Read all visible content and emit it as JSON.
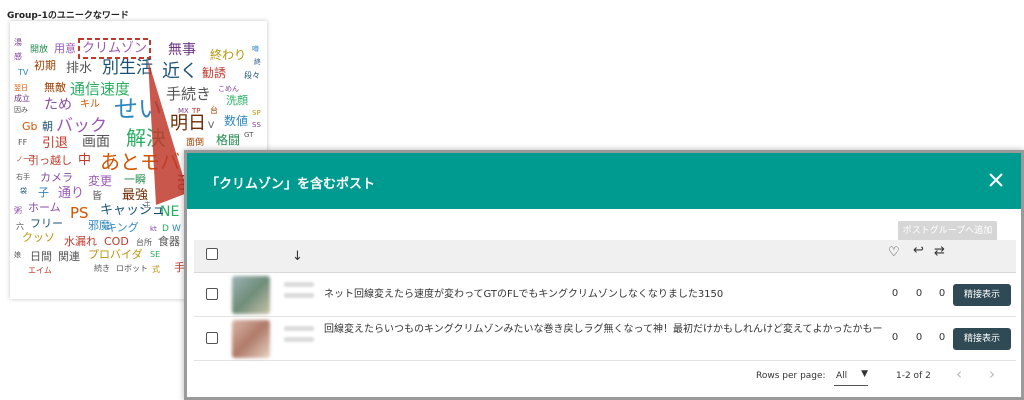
{
  "section_title": "Group-1のユニークなワード",
  "word_cloud": {
    "highlighted_word": "クリムゾン",
    "highlight_color": "#c0392b",
    "words": [
      {
        "text": "湯",
        "color": "#7d3c98"
      },
      {
        "text": "開放",
        "color": "#1f8a4c"
      },
      {
        "text": "用意",
        "color": "#9b59b6"
      },
      {
        "text": "クリムゾン",
        "color": "#9b59b6"
      },
      {
        "text": "無事",
        "color": "#6c3483"
      },
      {
        "text": "噂",
        "color": "#2e86c1"
      },
      {
        "text": "感",
        "color": "#7d3c98"
      },
      {
        "text": "初期",
        "color": "#a04000"
      },
      {
        "text": "排水",
        "color": "#555555"
      },
      {
        "text": "別生活",
        "color": "#1a5276"
      },
      {
        "text": "終わり",
        "color": "#b7950b"
      },
      {
        "text": "終",
        "color": "#1a5276"
      },
      {
        "text": "TV",
        "color": "#2e86c1"
      },
      {
        "text": "近く",
        "color": "#1a5276"
      },
      {
        "text": "勧誘",
        "color": "#c0392b"
      },
      {
        "text": "段々",
        "color": "#1a5276"
      },
      {
        "text": "翌日",
        "color": "#d35400"
      },
      {
        "text": "無敵",
        "color": "#a04000"
      },
      {
        "text": "通信速度",
        "color": "#27ae60"
      },
      {
        "text": "こめん",
        "color": "#7d3c98"
      },
      {
        "text": "成立",
        "color": "#6c3483"
      },
      {
        "text": "手続き",
        "color": "#555555"
      },
      {
        "text": "洗顔",
        "color": "#27ae60"
      },
      {
        "text": "ため",
        "color": "#884ea0"
      },
      {
        "text": "キル",
        "color": "#d35400"
      },
      {
        "text": "せい",
        "color": "#2e86c1"
      },
      {
        "text": "MX",
        "color": "#7d3c98"
      },
      {
        "text": "TP",
        "color": "#c0392b"
      },
      {
        "text": "台",
        "color": "#a04000"
      },
      {
        "text": "SP",
        "color": "#b7950b"
      },
      {
        "text": "因み",
        "color": "#555555"
      },
      {
        "text": "明日",
        "color": "#6e2c00"
      },
      {
        "text": "数値",
        "color": "#2e86c1"
      },
      {
        "text": "SS",
        "color": "#7d3c98"
      },
      {
        "text": "Gb",
        "color": "#d35400"
      },
      {
        "text": "朝",
        "color": "#1a5276"
      },
      {
        "text": "バック",
        "color": "#9b59b6"
      },
      {
        "text": "V",
        "color": "#555555"
      },
      {
        "text": "GT",
        "color": "#555555"
      },
      {
        "text": "引退",
        "color": "#c0392b"
      },
      {
        "text": "画面",
        "color": "#555555"
      },
      {
        "text": "解決",
        "color": "#27ae60"
      },
      {
        "text": "面倒",
        "color": "#a04000"
      },
      {
        "text": "格闘",
        "color": "#1f8a4c"
      },
      {
        "text": "FF",
        "color": "#555555"
      },
      {
        "text": "ノーチ",
        "color": "#c0392b"
      },
      {
        "text": "引っ越し",
        "color": "#c0392b"
      },
      {
        "text": "中",
        "color": "#c0392b"
      },
      {
        "text": "あとモバ",
        "color": "#d35400"
      },
      {
        "text": "カメラ",
        "color": "#884ea0"
      },
      {
        "text": "右手",
        "color": "#555555"
      },
      {
        "text": "変更",
        "color": "#9b59b6"
      },
      {
        "text": "一瞬",
        "color": "#1f8a4c"
      },
      {
        "text": "ま",
        "color": "#c0392b"
      },
      {
        "text": "袋",
        "color": "#1a5276"
      },
      {
        "text": "子",
        "color": "#2e86c1"
      },
      {
        "text": "通り",
        "color": "#9b59b6"
      },
      {
        "text": "皆",
        "color": "#555555"
      },
      {
        "text": "最強",
        "color": "#6e2c00"
      },
      {
        "text": "主",
        "color": "#555555"
      },
      {
        "text": "NE",
        "color": "#27ae60"
      },
      {
        "text": "粥",
        "color": "#884ea0"
      },
      {
        "text": "ホーム",
        "color": "#884ea0"
      },
      {
        "text": "PS",
        "color": "#d35400"
      },
      {
        "text": "キャッシュ",
        "color": "#1a5276"
      },
      {
        "text": "六",
        "color": "#555555"
      },
      {
        "text": "フリー",
        "color": "#1a5276"
      },
      {
        "text": "邪魔",
        "color": "#2e86c1"
      },
      {
        "text": "キング",
        "color": "#2e86c1"
      },
      {
        "text": "kt",
        "color": "#7d3c98"
      },
      {
        "text": "D",
        "color": "#27ae60"
      },
      {
        "text": "W",
        "color": "#2e86c1"
      },
      {
        "text": "クッソ",
        "color": "#b7950b"
      },
      {
        "text": "水漏れ",
        "color": "#c0392b"
      },
      {
        "text": "COD",
        "color": "#c0392b"
      },
      {
        "text": "台所",
        "color": "#555555"
      },
      {
        "text": "食器",
        "color": "#555555"
      },
      {
        "text": "娘",
        "color": "#555555"
      },
      {
        "text": "日間",
        "color": "#555555"
      },
      {
        "text": "関連",
        "color": "#555555"
      },
      {
        "text": "プロバイダ",
        "color": "#b7950b"
      },
      {
        "text": "SE",
        "color": "#27ae60"
      },
      {
        "text": "エイム",
        "color": "#c0392b"
      },
      {
        "text": "続き",
        "color": "#555555"
      },
      {
        "text": "ロボット",
        "color": "#555555"
      },
      {
        "text": "式",
        "color": "#b7950b"
      },
      {
        "text": "手",
        "color": "#c0392b"
      }
    ]
  },
  "modal": {
    "title": "「クリムゾン」を含むポスト",
    "add_group_label": "ポストグループへ追加",
    "header_color": "#009b90",
    "rows": [
      {
        "text": "ネット回線変えたら速度が変わってGTのFLでもキングクリムゾンしなくなりました3150",
        "likes": "0",
        "replies": "0",
        "reposts": "0",
        "button_label": "精接表示"
      },
      {
        "text": "回線変えたらいつものキングクリムゾンみたいな巻き戻しラグ無くなって神！最初だけかもしれんけど変えてよかったかもー",
        "likes": "0",
        "replies": "0",
        "reposts": "0",
        "button_label": "精接表示"
      }
    ],
    "footer": {
      "rows_per_page_label": "Rows per page:",
      "rows_per_page_value": "All",
      "range_text": "1-2 of 2"
    }
  }
}
